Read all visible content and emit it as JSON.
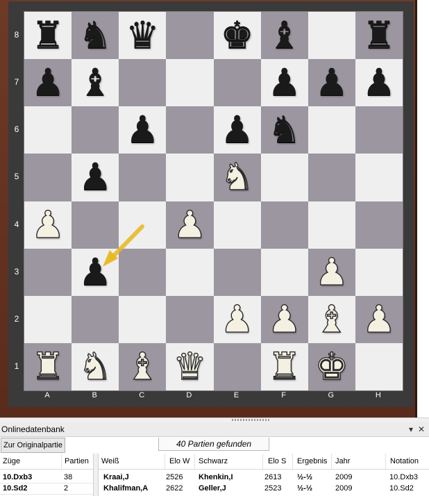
{
  "board": {
    "files": [
      "A",
      "B",
      "C",
      "D",
      "E",
      "F",
      "G",
      "H"
    ],
    "ranks": [
      "8",
      "7",
      "6",
      "5",
      "4",
      "3",
      "2",
      "1"
    ],
    "pieces": [
      [
        "r",
        "n",
        "q",
        "",
        "k",
        "b",
        "",
        "r"
      ],
      [
        "p",
        "b",
        "",
        "",
        "",
        "p",
        "p",
        "p"
      ],
      [
        "",
        "",
        "p",
        "",
        "p",
        "n",
        "",
        ""
      ],
      [
        "",
        "p",
        "",
        "",
        "N",
        "",
        "",
        ""
      ],
      [
        "P",
        "",
        "",
        "P",
        "",
        "",
        "",
        ""
      ],
      [
        "",
        "p",
        "",
        "",
        "",
        "",
        "P",
        ""
      ],
      [
        "",
        "",
        "",
        "",
        "P",
        "P",
        "B",
        "P"
      ],
      [
        "R",
        "N",
        "B",
        "Q",
        "",
        "R",
        "K",
        ""
      ]
    ],
    "arrow": {
      "from": "c4",
      "to": "b3",
      "color": "#e8b820"
    },
    "colors": {
      "light": "#efefef",
      "dark": "#9c96a0",
      "frame": "#6e3a26"
    }
  },
  "panel": {
    "title": "Onlinedatenbank",
    "pin_glyph": "▾",
    "close_glyph": "✕",
    "original_button": "Zur Originalpartie",
    "found_text": "40 Partien gefunden",
    "moves_table": {
      "headers": [
        "Züge",
        "Partien"
      ],
      "rows": [
        {
          "move": "10.Dxb3",
          "games": "38"
        },
        {
          "move": "10.Sd2",
          "games": "2"
        }
      ]
    },
    "games_table": {
      "headers": [
        "Weiß",
        "Elo W",
        "Schwarz",
        "Elo S",
        "Ergebnis",
        "Jahr",
        "Notation"
      ],
      "rows": [
        {
          "white": "Kraai,J",
          "elo_w": "2526",
          "black": "Khenkin,I",
          "elo_s": "2613",
          "result": "½-½",
          "year": "2009",
          "notation": "10.Dxb3"
        },
        {
          "white": "Khalifman,A",
          "elo_w": "2622",
          "black": "Geller,J",
          "elo_s": "2523",
          "result": "½-½",
          "year": "2009",
          "notation": "10.Sd2"
        }
      ]
    }
  }
}
